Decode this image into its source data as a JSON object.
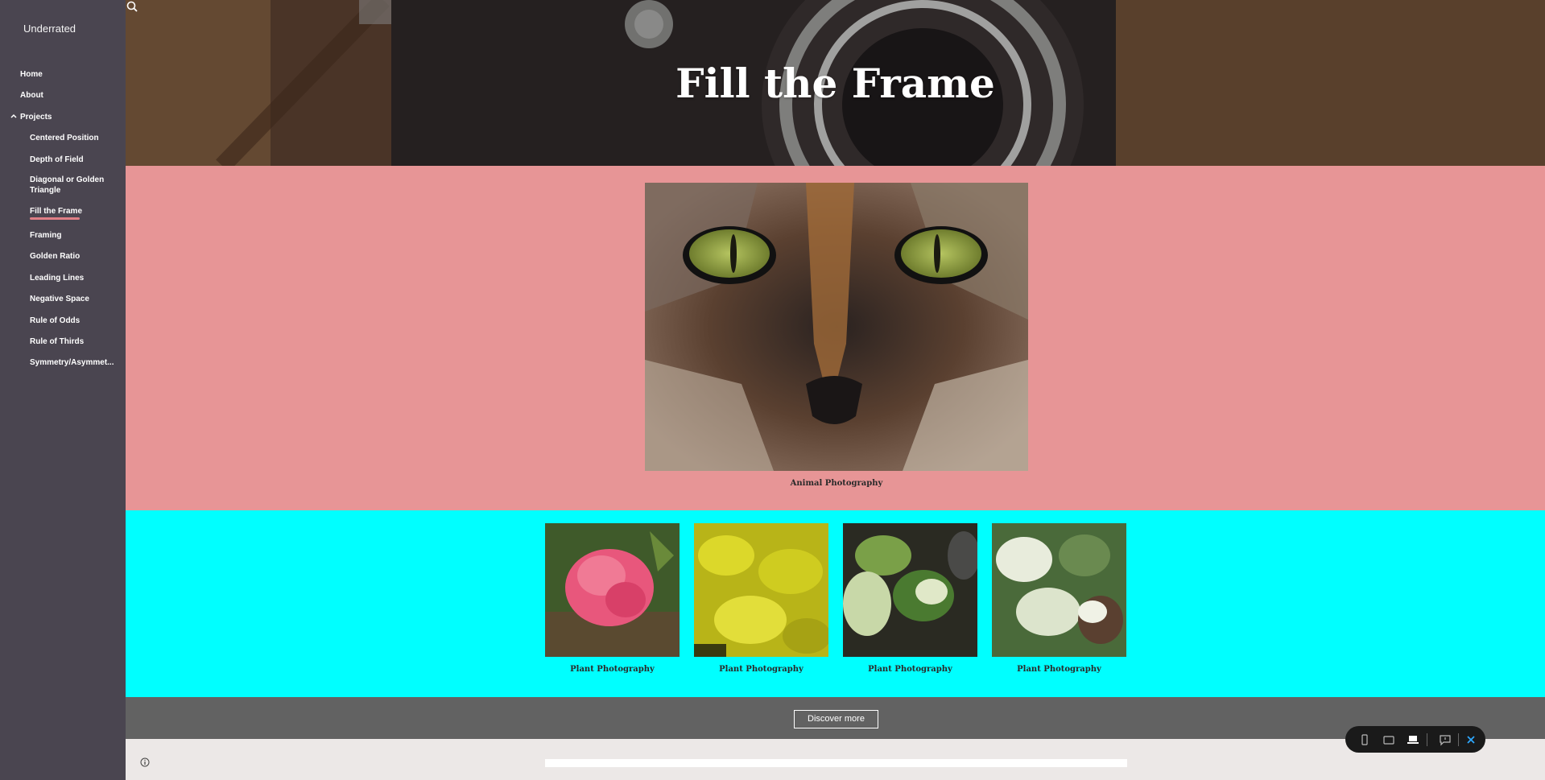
{
  "site": {
    "title": "Underrated"
  },
  "nav": {
    "home": "Home",
    "about": "About",
    "projects": "Projects",
    "sub_items": [
      "Centered Position",
      "Depth of Field",
      "Diagonal or Golden Triangle",
      "Fill the Frame",
      "Framing",
      "Golden Ratio",
      "Leading Lines",
      "Negative Space",
      "Rule of Odds",
      "Rule of Thirds",
      "Symmetry/Asymmet..."
    ],
    "active_item": "Fill the Frame",
    "active_color": "#e07f86"
  },
  "hero": {
    "title": "Fill the Frame"
  },
  "featured": {
    "caption": "Animal Photography"
  },
  "gallery": {
    "captions": [
      "Plant Photography",
      "Plant Photography",
      "Plant Photography",
      "Plant Photography"
    ]
  },
  "cta": {
    "label": "Discover more"
  },
  "colors": {
    "sidebar": "#4a4550",
    "pink_section": "#e79596",
    "cyan_section": "#00ffff",
    "dark_strip": "#626262",
    "footer": "#ece8e7"
  },
  "icons": {
    "search": "search-icon",
    "info": "info-icon",
    "projects_toggle": "chevron-up-icon",
    "preview_toolbar": [
      "phone-icon",
      "tablet-icon",
      "laptop-icon",
      "feedback-icon",
      "close-icon"
    ]
  }
}
